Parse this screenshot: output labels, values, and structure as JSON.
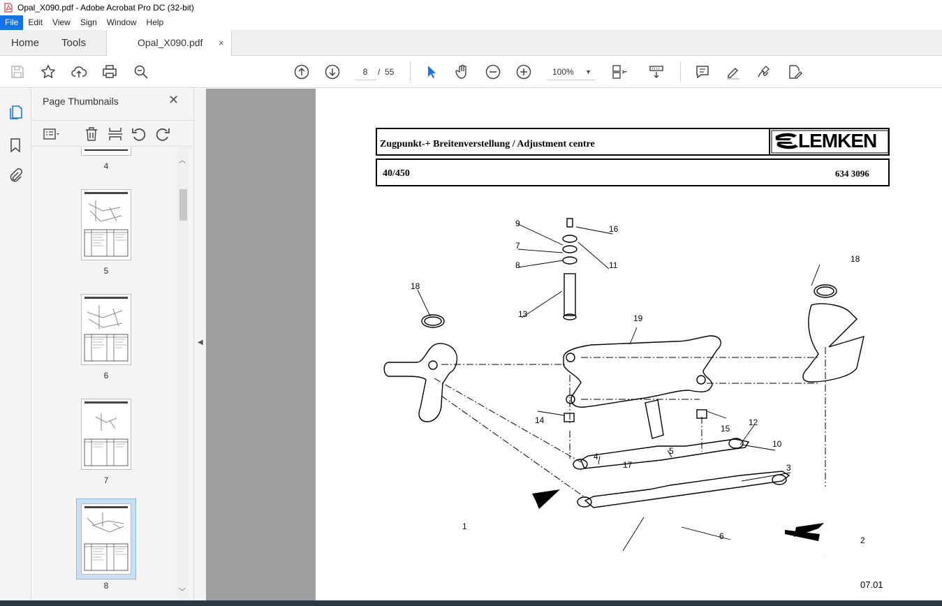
{
  "window": {
    "title": "Opal_X090.pdf - Adobe Acrobat Pro DC (32-bit)"
  },
  "menu": {
    "items": [
      "File",
      "Edit",
      "View",
      "Sign",
      "Window",
      "Help"
    ]
  },
  "tabs": {
    "home": "Home",
    "tools": "Tools",
    "document": "Opal_X090.pdf",
    "close": "×"
  },
  "toolbar": {
    "current_page": "8",
    "page_separator": "/",
    "total_pages": "55",
    "zoom": "100%"
  },
  "icons": {
    "save": "save-icon",
    "bookmark": "star-icon",
    "upload": "cloud-upload-icon",
    "print": "printer-icon",
    "search": "search-icon",
    "page_up": "arrow-up-circle-icon",
    "page_down": "arrow-down-circle-icon",
    "select": "pointer-icon",
    "hand": "hand-icon",
    "zoom_out": "minus-circle-icon",
    "zoom_in": "plus-circle-icon",
    "fit": "fit-page-icon",
    "scroll": "scroll-mode-icon",
    "comment": "comment-icon",
    "highlight": "pen-icon",
    "sign": "sign-icon",
    "edit": "edit-pdf-icon"
  },
  "sidebar": {
    "panel_title": "Page Thumbnails",
    "close": "✕",
    "thumbnails": [
      {
        "label": "4"
      },
      {
        "label": "5"
      },
      {
        "label": "6"
      },
      {
        "label": "7"
      },
      {
        "label": "8",
        "selected": true
      }
    ]
  },
  "page": {
    "header_title": "Zugpunkt-+ Breitenverstellung / Adjustment centre",
    "logo_text": "LEMKEN",
    "model": "40/450",
    "part_number": "634 3096",
    "footer": "07.01",
    "callouts": [
      "9",
      "16",
      "7",
      "11",
      "8",
      "18",
      "13",
      "18",
      "19",
      "14",
      "15",
      "12",
      "10",
      "17",
      "4",
      "5",
      "3",
      "1",
      "6",
      "2"
    ]
  },
  "colors": {
    "accent": "#1473e6",
    "viewport_bg": "#9e9e9e",
    "panel_bg": "#f4f4f4"
  }
}
